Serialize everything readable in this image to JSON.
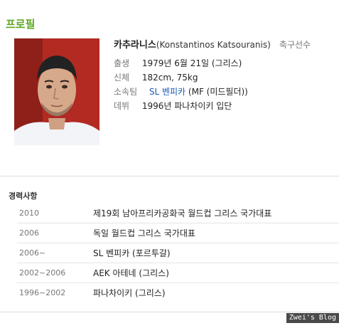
{
  "profile": {
    "title": "프로필",
    "name_ko": "카추라니스",
    "name_en": "(Konstantinos Katsouranis)",
    "occupation": "축구선수",
    "rows": [
      {
        "label": "출생",
        "value": "1979년 6월 21일 (그리스)"
      },
      {
        "label": "신체",
        "value": "182cm, 75kg"
      },
      {
        "label": "소속팀",
        "link": "SL 벤피카",
        "value": "(MF (미드필더))"
      },
      {
        "label": "데뷔",
        "value": "1996년 파나차이키 입단"
      }
    ]
  },
  "career": {
    "title": "경력사항",
    "items": [
      {
        "year": "2010",
        "desc": "제19회 남아프리카공화국 월드컵 그리스 국가대표"
      },
      {
        "year": "2006",
        "desc": "독일 월드컵 그리스 국가대표"
      },
      {
        "year": "2006~",
        "desc": "SL 벤피카 (포르투갈)"
      },
      {
        "year": "2002~2006",
        "desc": "AEK 아테네 (그리스)"
      },
      {
        "year": "1996~2002",
        "desc": "파나차이키 (그리스)"
      }
    ]
  },
  "watermark": "Zwei's Blog",
  "colors": {
    "section_title": "#5ea823",
    "link": "#1a5bb8"
  }
}
